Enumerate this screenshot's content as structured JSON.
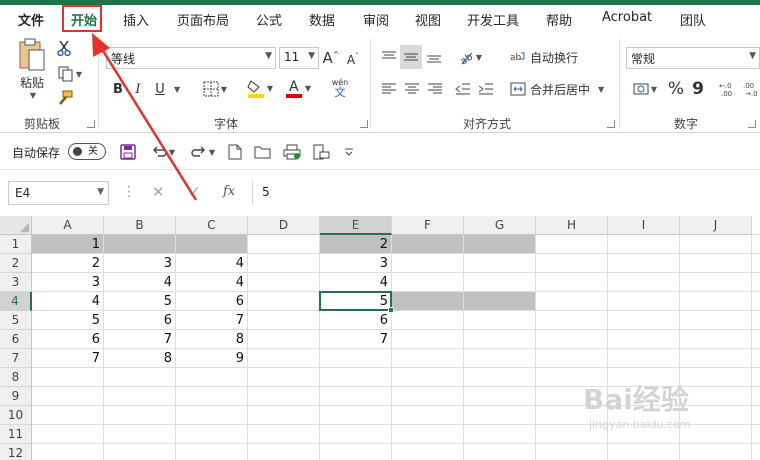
{
  "ribbon_tabs": [
    "文件",
    "开始",
    "插入",
    "页面布局",
    "公式",
    "数据",
    "审阅",
    "视图",
    "开发工具",
    "帮助",
    "Acrobat",
    "团队"
  ],
  "clipboard": {
    "paste_label": "粘贴",
    "group_label": "剪贴板"
  },
  "font": {
    "name": "等线",
    "size": "11",
    "bold": "B",
    "italic": "I",
    "underline": "U",
    "phonetic": "wén",
    "group_label": "字体",
    "fill_color": "#ffd800",
    "font_color": "#e00000"
  },
  "alignment": {
    "wrap_text": "自动换行",
    "merge_center": "合并后居中",
    "group_label": "对齐方式"
  },
  "number": {
    "format": "常规",
    "percent": "%",
    "comma": "9",
    "group_label": "数字"
  },
  "qat": {
    "autosave_label": "自动保存",
    "autosave_state": "关"
  },
  "formula_bar": {
    "name_box": "E4",
    "cancel": "✕",
    "enter": "✓",
    "fx": "fx",
    "content": "5"
  },
  "sheet": {
    "columns": [
      "A",
      "B",
      "C",
      "D",
      "E",
      "F",
      "G",
      "H",
      "I",
      "J"
    ],
    "rows": [
      "1",
      "2",
      "3",
      "4",
      "5",
      "6",
      "7",
      "8",
      "9",
      "10",
      "11",
      "12"
    ],
    "active_cell": "E4",
    "cells": {
      "A1": "1",
      "A2": "2",
      "A3": "3",
      "A4": "4",
      "A5": "5",
      "A6": "6",
      "A7": "7",
      "B2": "3",
      "B3": "4",
      "B4": "5",
      "B5": "6",
      "B6": "7",
      "B7": "8",
      "C2": "4",
      "C3": "4",
      "C4": "6",
      "C5": "7",
      "C6": "8",
      "C7": "9",
      "E1": "2",
      "E2": "3",
      "E3": "4",
      "E4": "5",
      "E5": "6",
      "E6": "7"
    },
    "gray_fill": "#c0c0c0",
    "accent": "#217346"
  },
  "annotation": {
    "color": "#e6322d"
  },
  "watermark": {
    "main": "Bai经验",
    "sub": "jingyan.baidu.com"
  }
}
